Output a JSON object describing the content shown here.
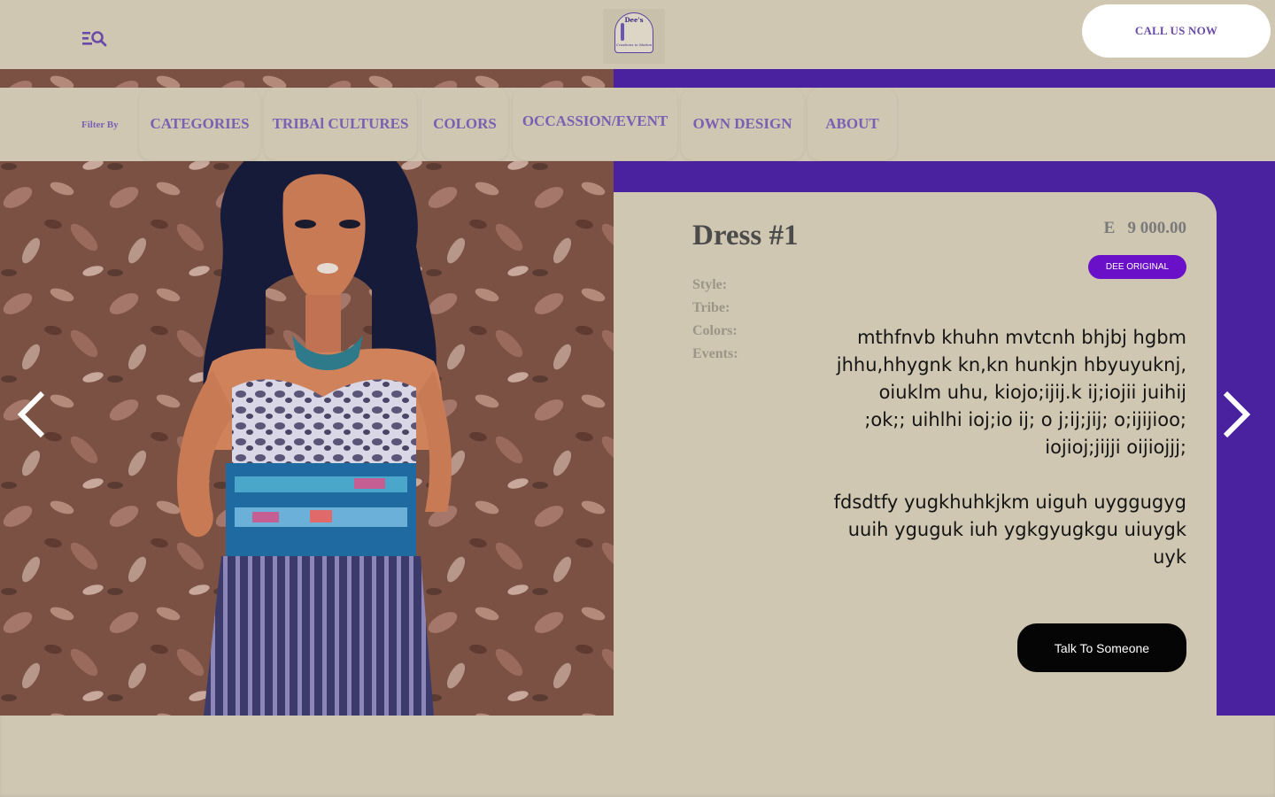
{
  "header": {
    "menu_icon": "menu-search-icon",
    "logo_text": "Dee's",
    "logo_subtitle": "Creations in Motion",
    "call_label": "CALL US NOW"
  },
  "filter": {
    "label": "Filter By",
    "tabs": [
      "CATEGORIES",
      "TRIBAl CULTURES",
      "COLORS",
      "OCCASSION/EVENT",
      "OWN DESIGN",
      "ABOUT"
    ]
  },
  "product": {
    "title": "Dress #1",
    "price": "E   9 000.00",
    "badge": "DEE ORIGINAL",
    "attributes": [
      "Style:",
      "Tribe:",
      "Colors:",
      "Events:"
    ],
    "description": [
      "mthfnvb khuhn mvtcnh bhjbj hgbm jhhu,hhygnk kn,kn hunkjn hbyuyuknj, oiuklm uhu, kiojo;ijij.k ij;iojii juihij ;ok;; uihlhi ioj;io ij; o j;ij;jij; o;ijijioo; iojioj;jijji oijiojjj;",
      "fdsdtfy yugkhuhkjkm uiguh uyggugyg uuih yguguk iuh ygkgyugkgu uiuygk uyk"
    ],
    "cta_label": "Talk To Someone"
  },
  "nav": {
    "prev_icon": "chevron-left-icon",
    "next_icon": "chevron-right-icon"
  },
  "colors": {
    "background": "#cfc7b2",
    "accent_purple": "#4a22a0",
    "tab_text": "#7b5fb2",
    "badge": "#6a10c9",
    "cta": "#050505"
  }
}
